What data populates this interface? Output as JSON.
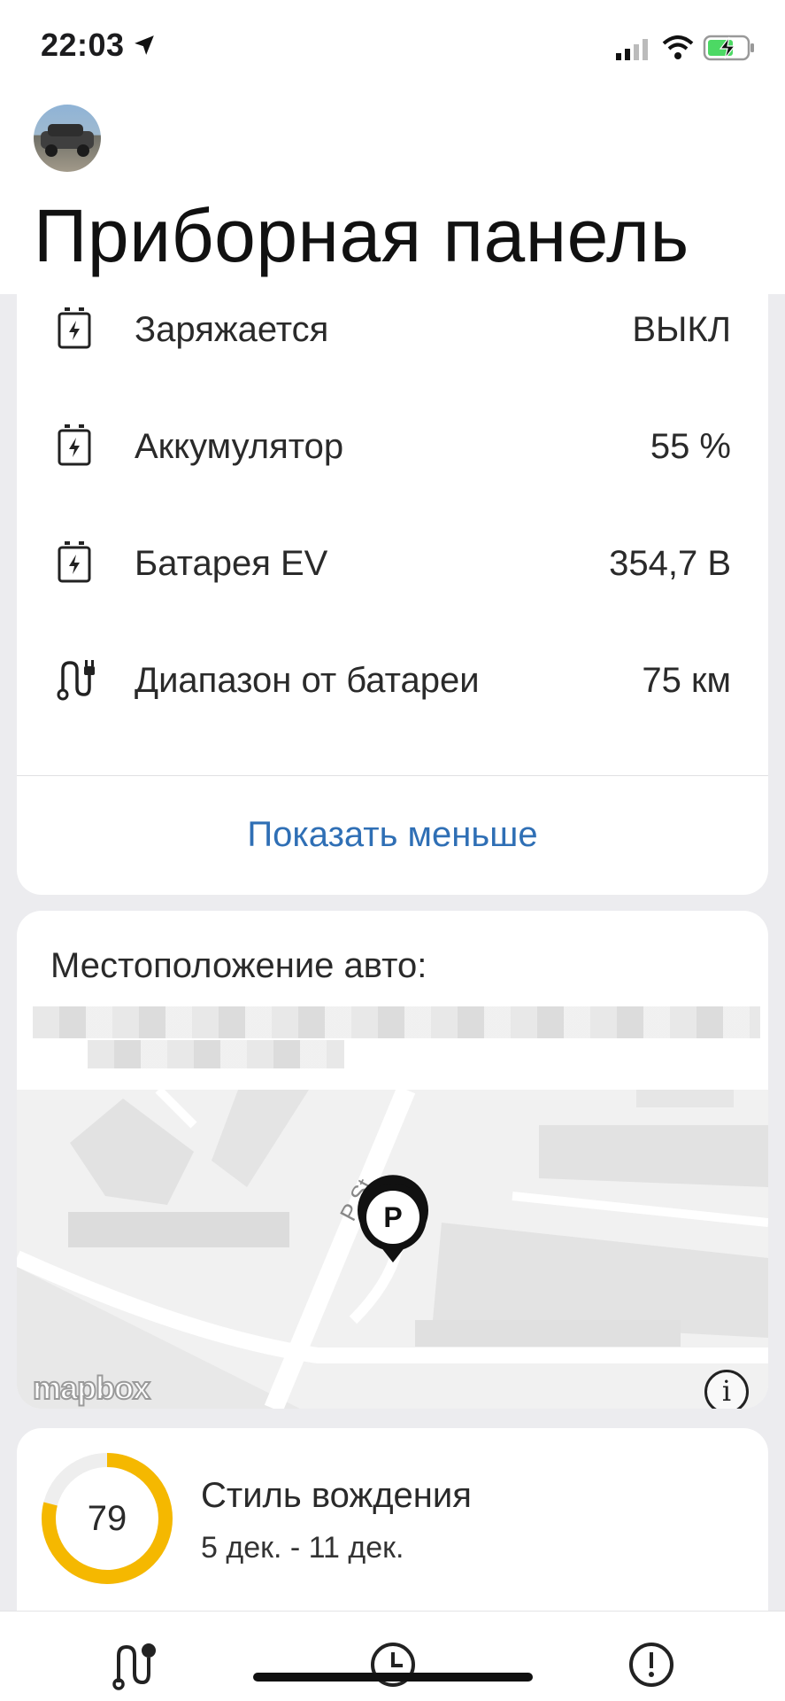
{
  "status_bar": {
    "time": "22:03",
    "icons": [
      "location-arrow-icon",
      "cellular-signal-icon",
      "wifi-icon",
      "battery-charging-icon"
    ],
    "battery_color": "#4cd964"
  },
  "header": {
    "title": "Приборная панель",
    "avatar": "vehicle-photo-avatar"
  },
  "stats": {
    "rows": [
      {
        "icon": "battery-charge-icon",
        "label": "Заряжается",
        "value": "ВЫКЛ"
      },
      {
        "icon": "battery-charge-icon",
        "label": "Аккумулятор",
        "value": "55 %"
      },
      {
        "icon": "battery-charge-icon",
        "label": "Батарея EV",
        "value": "354,7 В"
      },
      {
        "icon": "route-plug-icon",
        "label": "Диапазон от батареи",
        "value": "75 км"
      }
    ],
    "show_less_label": "Показать меньше"
  },
  "location": {
    "title": "Местоположение авто:",
    "marker_letter": "P",
    "street_label": "P St",
    "map_attribution": "mapbox",
    "info_symbol": "i"
  },
  "driving_style": {
    "score": "79",
    "score_fraction": 0.79,
    "title": "Стиль вождения",
    "date_range": "5 дек. - 11 дек.",
    "ring_color": "#f5b800"
  },
  "tabbar": {
    "tabs": [
      "route-icon",
      "clock-icon",
      "alert-icon"
    ]
  },
  "colors": {
    "accent_link": "#2f6fb5",
    "background": "#ececef"
  }
}
